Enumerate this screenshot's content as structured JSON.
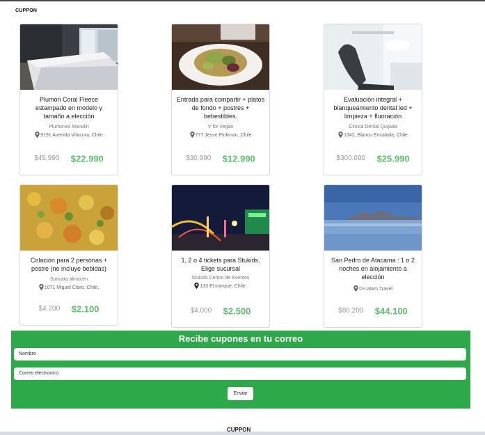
{
  "brand": "CUPPON",
  "deals": [
    {
      "title": "Plumón Coral Fleece estampado en modelo y tamaño a elección",
      "merchant": "Plumones Manolin",
      "address": "9191 Avenida Vitacura, Chile",
      "old_price": "$45.990",
      "new_price": "$22.990"
    },
    {
      "title": "Entrada para compartir + platos de fondo + postres + bebestibles.",
      "merchant": "V for Vegan",
      "address": "777 Jesse Pinkman, Chile",
      "old_price": "$30.990",
      "new_price": "$12.990"
    },
    {
      "title": "Evaluación integral + blanqueamiento dental led + limpieza + fluoración",
      "merchant": "Clinica Dental Quijada",
      "address": "1342, Blanco Encalada, Chile",
      "old_price": "$300.000",
      "new_price": "$25.990"
    },
    {
      "title": "Colación para 2 personas + postre (no incluye bebidas)",
      "merchant": "Suricata almacen",
      "address": "1071 Miguel Claro, Chile.",
      "old_price": "$4.200",
      "new_price": "$2.100"
    },
    {
      "title": "1, 2 o 4 tickets para Stukids. Elige sucursal",
      "merchant": "Stukids Centro de Eventos",
      "address": "133 El tranque, Chile.",
      "old_price": "$4.000",
      "new_price": "$2.500"
    },
    {
      "title": "San Pedro de Atacama : 1 o 2 noches en alojamiento a elección",
      "merchant": "",
      "address": "D-Latam Travel",
      "old_price": "$80.200",
      "new_price": "$44.100"
    }
  ],
  "newsletter": {
    "title": "Recibe cupones en tu correo",
    "name_placeholder": "Nombre",
    "email_placeholder": "Correo electronico",
    "submit_label": "Enviar"
  },
  "footer": {
    "brand": "CUPPON"
  },
  "icons": {
    "location": "map-pin-icon"
  },
  "colors": {
    "accent": "#2ea94a",
    "price": "#5cc06a"
  }
}
